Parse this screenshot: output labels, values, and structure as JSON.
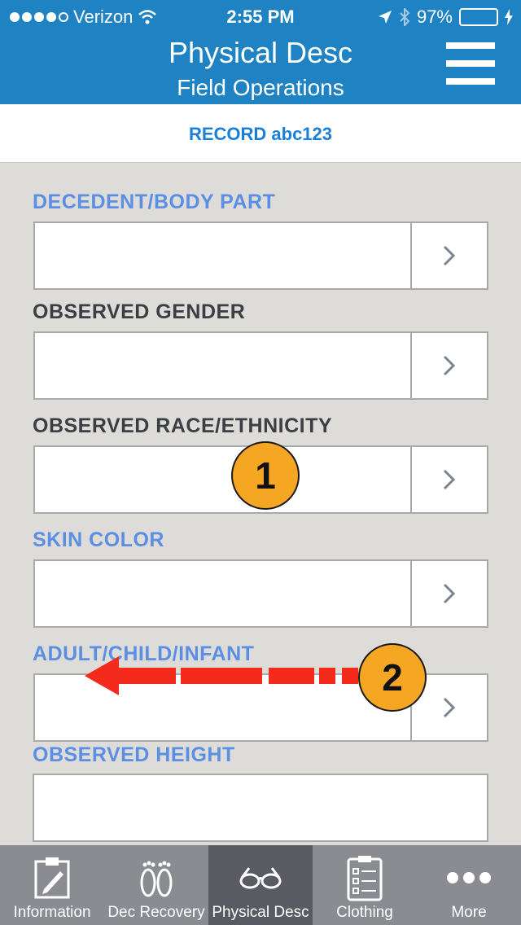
{
  "status_bar": {
    "carrier": "Verizon",
    "time": "2:55 PM",
    "battery": "97%",
    "battery_level": 0.97
  },
  "header": {
    "title": "Physical Desc",
    "subtitle": "Field Operations"
  },
  "record": {
    "label": "RECORD abc123"
  },
  "form": {
    "fields": [
      {
        "label": "DECEDENT/BODY PART",
        "value": ""
      },
      {
        "label": "OBSERVED GENDER",
        "value": ""
      },
      {
        "label": "OBSERVED RACE/ETHNICITY",
        "value": ""
      },
      {
        "label": "SKIN COLOR",
        "value": ""
      },
      {
        "label": "ADULT/CHILD/INFANT",
        "value": ""
      },
      {
        "label": "OBSERVED HEIGHT",
        "value": ""
      }
    ]
  },
  "annotations": {
    "badge1": "1",
    "badge2": "2"
  },
  "tabbar": {
    "tabs": [
      {
        "label": "Information",
        "icon": "clipboard-pen-icon"
      },
      {
        "label": "Dec Recovery",
        "icon": "footprints-icon"
      },
      {
        "label": "Physical Desc",
        "icon": "glasses-icon",
        "active": true
      },
      {
        "label": "Clothing",
        "icon": "checklist-icon"
      },
      {
        "label": "More",
        "icon": "more-dots-icon"
      }
    ]
  }
}
